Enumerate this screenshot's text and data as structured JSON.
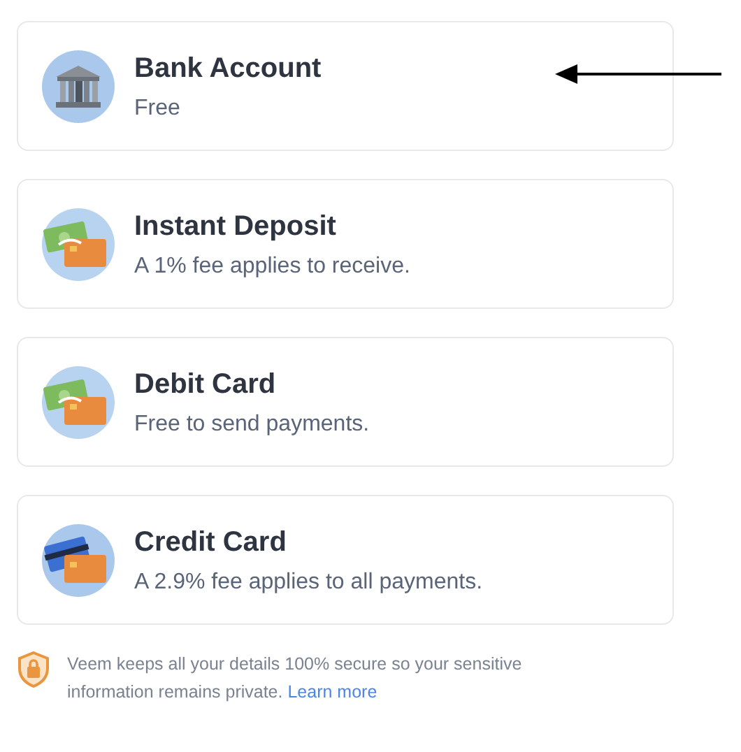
{
  "methods": [
    {
      "kind": "bank",
      "title": "Bank Account",
      "subtitle": "Free"
    },
    {
      "kind": "cash",
      "title": "Instant Deposit",
      "subtitle": "A 1% fee applies to receive."
    },
    {
      "kind": "cash",
      "title": "Debit Card",
      "subtitle": "Free to send payments."
    },
    {
      "kind": "card",
      "title": "Credit Card",
      "subtitle": "A 2.9% fee applies to all payments."
    }
  ],
  "notice": {
    "text": "Veem keeps all your details 100% secure so your sensitive information remains private.",
    "link": "Learn more"
  }
}
